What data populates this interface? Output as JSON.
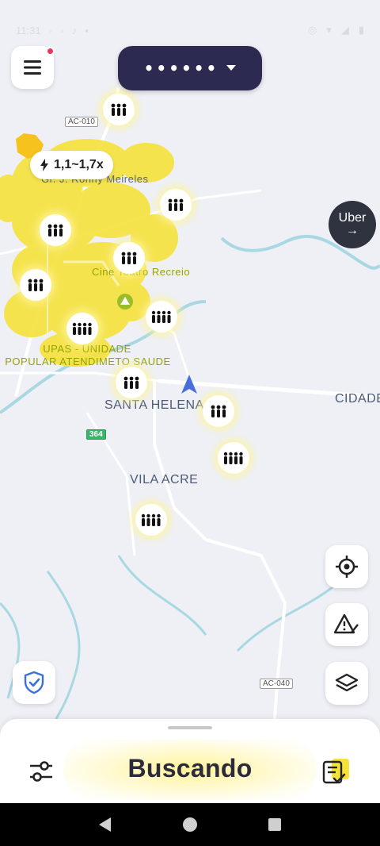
{
  "status_bar": {
    "time": "11:31",
    "left_icons": [
      "notification-icon",
      "messenger-icon",
      "tiktok-icon",
      "mail-icon"
    ],
    "right_icons": [
      "alarm-icon",
      "wifi-icon",
      "signal-icon",
      "battery-icon"
    ]
  },
  "header": {
    "password_mask": "••••••",
    "menu_has_notification": true
  },
  "surge": {
    "label": "1,1~1,7x"
  },
  "map": {
    "labels": {
      "ronny": "Gr. J. Ronny Meireles",
      "cine": "Cine Teatro Recreio",
      "upas_line1": "UPAS - UNIDADE",
      "upas_line2": "POPULAR ATENDIMETO SAUDE",
      "santa_helena": "SANTA HELENA",
      "vila_acre": "VILA ACRE",
      "cidade": "CIDADE"
    },
    "roads": {
      "ac010": "AC-010",
      "r364": "364",
      "ac040": "AC-040"
    }
  },
  "uber": {
    "label": "Uber",
    "arrow": "→"
  },
  "bottom": {
    "status": "Buscando"
  },
  "colors": {
    "heat": "#f5e13a",
    "pill": "#2d2a52",
    "notif": "#f0325b",
    "uber": "#2f3340"
  }
}
